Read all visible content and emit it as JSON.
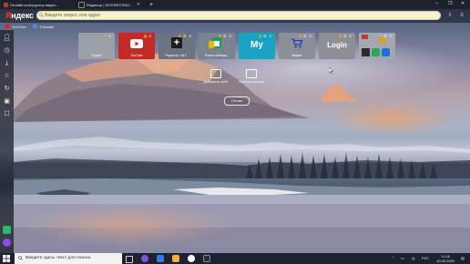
{
  "tabs": [
    {
      "label": "Онлайн конструктор видео...",
      "favicon_color": "#c0392b",
      "active": false
    },
    {
      "label": "Редактор | INTERESTING...",
      "favicon_color": "#222222",
      "active": true
    }
  ],
  "window_controls": {
    "minimize": "–",
    "restore": "❐",
    "close": "✕"
  },
  "browser": {
    "logo_first": "Я",
    "logo_rest": "ндекс",
    "address_placeholder": "Введите запрос или адрес"
  },
  "bookmarks": [
    {
      "label": "YouTube",
      "favicon_color": "#e62117"
    },
    {
      "label": "Translate",
      "favicon_color": "#4a90e2"
    }
  ],
  "tiles": [
    {
      "caption": "Яндекс",
      "type": "yandex",
      "bg": "#9aa0a6"
    },
    {
      "caption": "YouTube",
      "type": "youtube",
      "bg": "#c22b25"
    },
    {
      "caption": "Редактор | INT...",
      "type": "plus",
      "bg": "#6d7282"
    },
    {
      "caption": "Новая таблица...",
      "type": "sheet",
      "bg": "#7a8392"
    },
    {
      "caption": "",
      "type": "my",
      "text": "My",
      "bg": "#19a2c4"
    },
    {
      "caption": "Маркет",
      "type": "market",
      "bg": "#8b8f98"
    },
    {
      "caption": "",
      "type": "login",
      "text": "Login",
      "bg": "#8d8f97"
    },
    {
      "caption": "",
      "type": "misc",
      "bg": "#a3a7b0"
    }
  ],
  "tile_controls": {
    "pin": "🔒",
    "settings": "⚙",
    "close": "✕"
  },
  "actions": [
    {
      "label": "Добавить сайт"
    },
    {
      "label": "Галерея фонов"
    }
  ],
  "all_settings_label": "Готово",
  "taskbar": {
    "search_text": "Введите здесь текст для поиска",
    "language": "РУС",
    "time": "11:16",
    "date": "10.09.2020"
  },
  "colors": {
    "yandex_red": "#ff3b2f",
    "address_bg": "#f5f2d4",
    "taskbar_bg": "#1d2130"
  }
}
